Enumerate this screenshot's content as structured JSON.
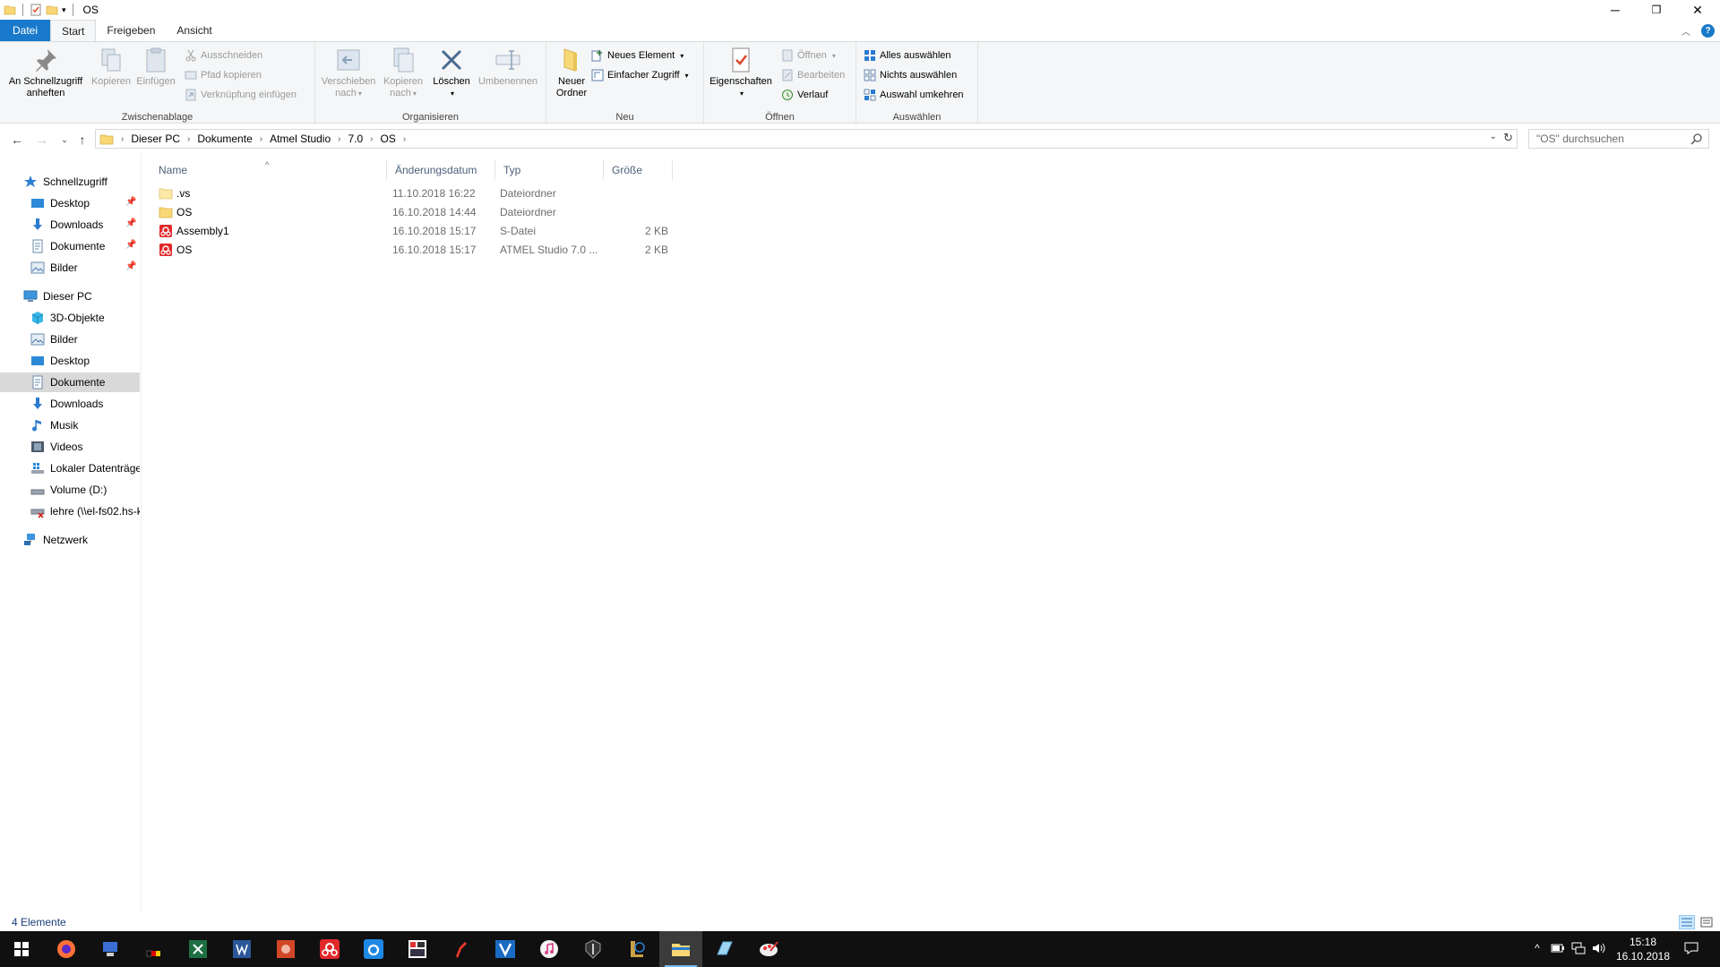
{
  "window": {
    "title": "OS",
    "minimize": "─",
    "maximize": "❐",
    "close": "✕"
  },
  "tabs": [
    "Datei",
    "Start",
    "Freigeben",
    "Ansicht"
  ],
  "ribbon": {
    "clipboard": {
      "label": "Zwischenablage",
      "pin_quick_access": [
        "An Schnellzugriff",
        "anheften"
      ],
      "copy": "Kopieren",
      "paste": "Einfügen",
      "cut": "Ausschneiden",
      "copy_path": "Pfad kopieren",
      "paste_shortcut": "Verknüpfung einfügen"
    },
    "organize": {
      "label": "Organisieren",
      "move_to": [
        "Verschieben",
        "nach"
      ],
      "copy_to": [
        "Kopieren",
        "nach"
      ],
      "delete": "Löschen",
      "rename": "Umbenennen"
    },
    "new": {
      "label": "Neu",
      "new_folder": [
        "Neuer",
        "Ordner"
      ],
      "new_item": "Neues Element",
      "easy_access": "Einfacher Zugriff"
    },
    "open": {
      "label": "Öffnen",
      "properties": "Eigenschaften",
      "open": "Öffnen",
      "edit": "Bearbeiten",
      "history": "Verlauf"
    },
    "select": {
      "label": "Auswählen",
      "select_all": "Alles auswählen",
      "select_none": "Nichts auswählen",
      "invert": "Auswahl umkehren"
    }
  },
  "address": {
    "crumbs": [
      "Dieser PC",
      "Dokumente",
      "Atmel Studio",
      "7.0",
      "OS"
    ],
    "search_placeholder": "\"OS\" durchsuchen"
  },
  "nav": {
    "quick_access": "Schnellzugriff",
    "quick_items": [
      "Desktop",
      "Downloads",
      "Dokumente",
      "Bilder"
    ],
    "this_pc": "Dieser PC",
    "pc_items": [
      "3D-Objekte",
      "Bilder",
      "Desktop",
      "Dokumente",
      "Downloads",
      "Musik",
      "Videos",
      "Lokaler Datenträger",
      "Volume (D:)",
      "lehre (\\\\el-fs02.hs-k"
    ],
    "network": "Netzwerk"
  },
  "columns": {
    "name": "Name",
    "date": "Änderungsdatum",
    "type": "Typ",
    "size": "Größe"
  },
  "files": [
    {
      "name": ".vs",
      "date": "11.10.2018 16:22",
      "type": "Dateiordner",
      "size": ""
    },
    {
      "name": "OS",
      "date": "16.10.2018 14:44",
      "type": "Dateiordner",
      "size": ""
    },
    {
      "name": "Assembly1",
      "date": "16.10.2018 15:17",
      "type": "S-Datei",
      "size": "2 KB"
    },
    {
      "name": "OS",
      "date": "16.10.2018 15:17",
      "type": "ATMEL Studio 7.0 ...",
      "size": "2 KB"
    }
  ],
  "status": {
    "count": "4 Elemente"
  },
  "taskbar": {
    "time": "15:18",
    "date": "16.10.2018"
  },
  "colors": {
    "file_tab": "#1979ca",
    "selection": "#d9d9d9",
    "folder": "#f8d775",
    "atmel_red": "#e2282a"
  }
}
